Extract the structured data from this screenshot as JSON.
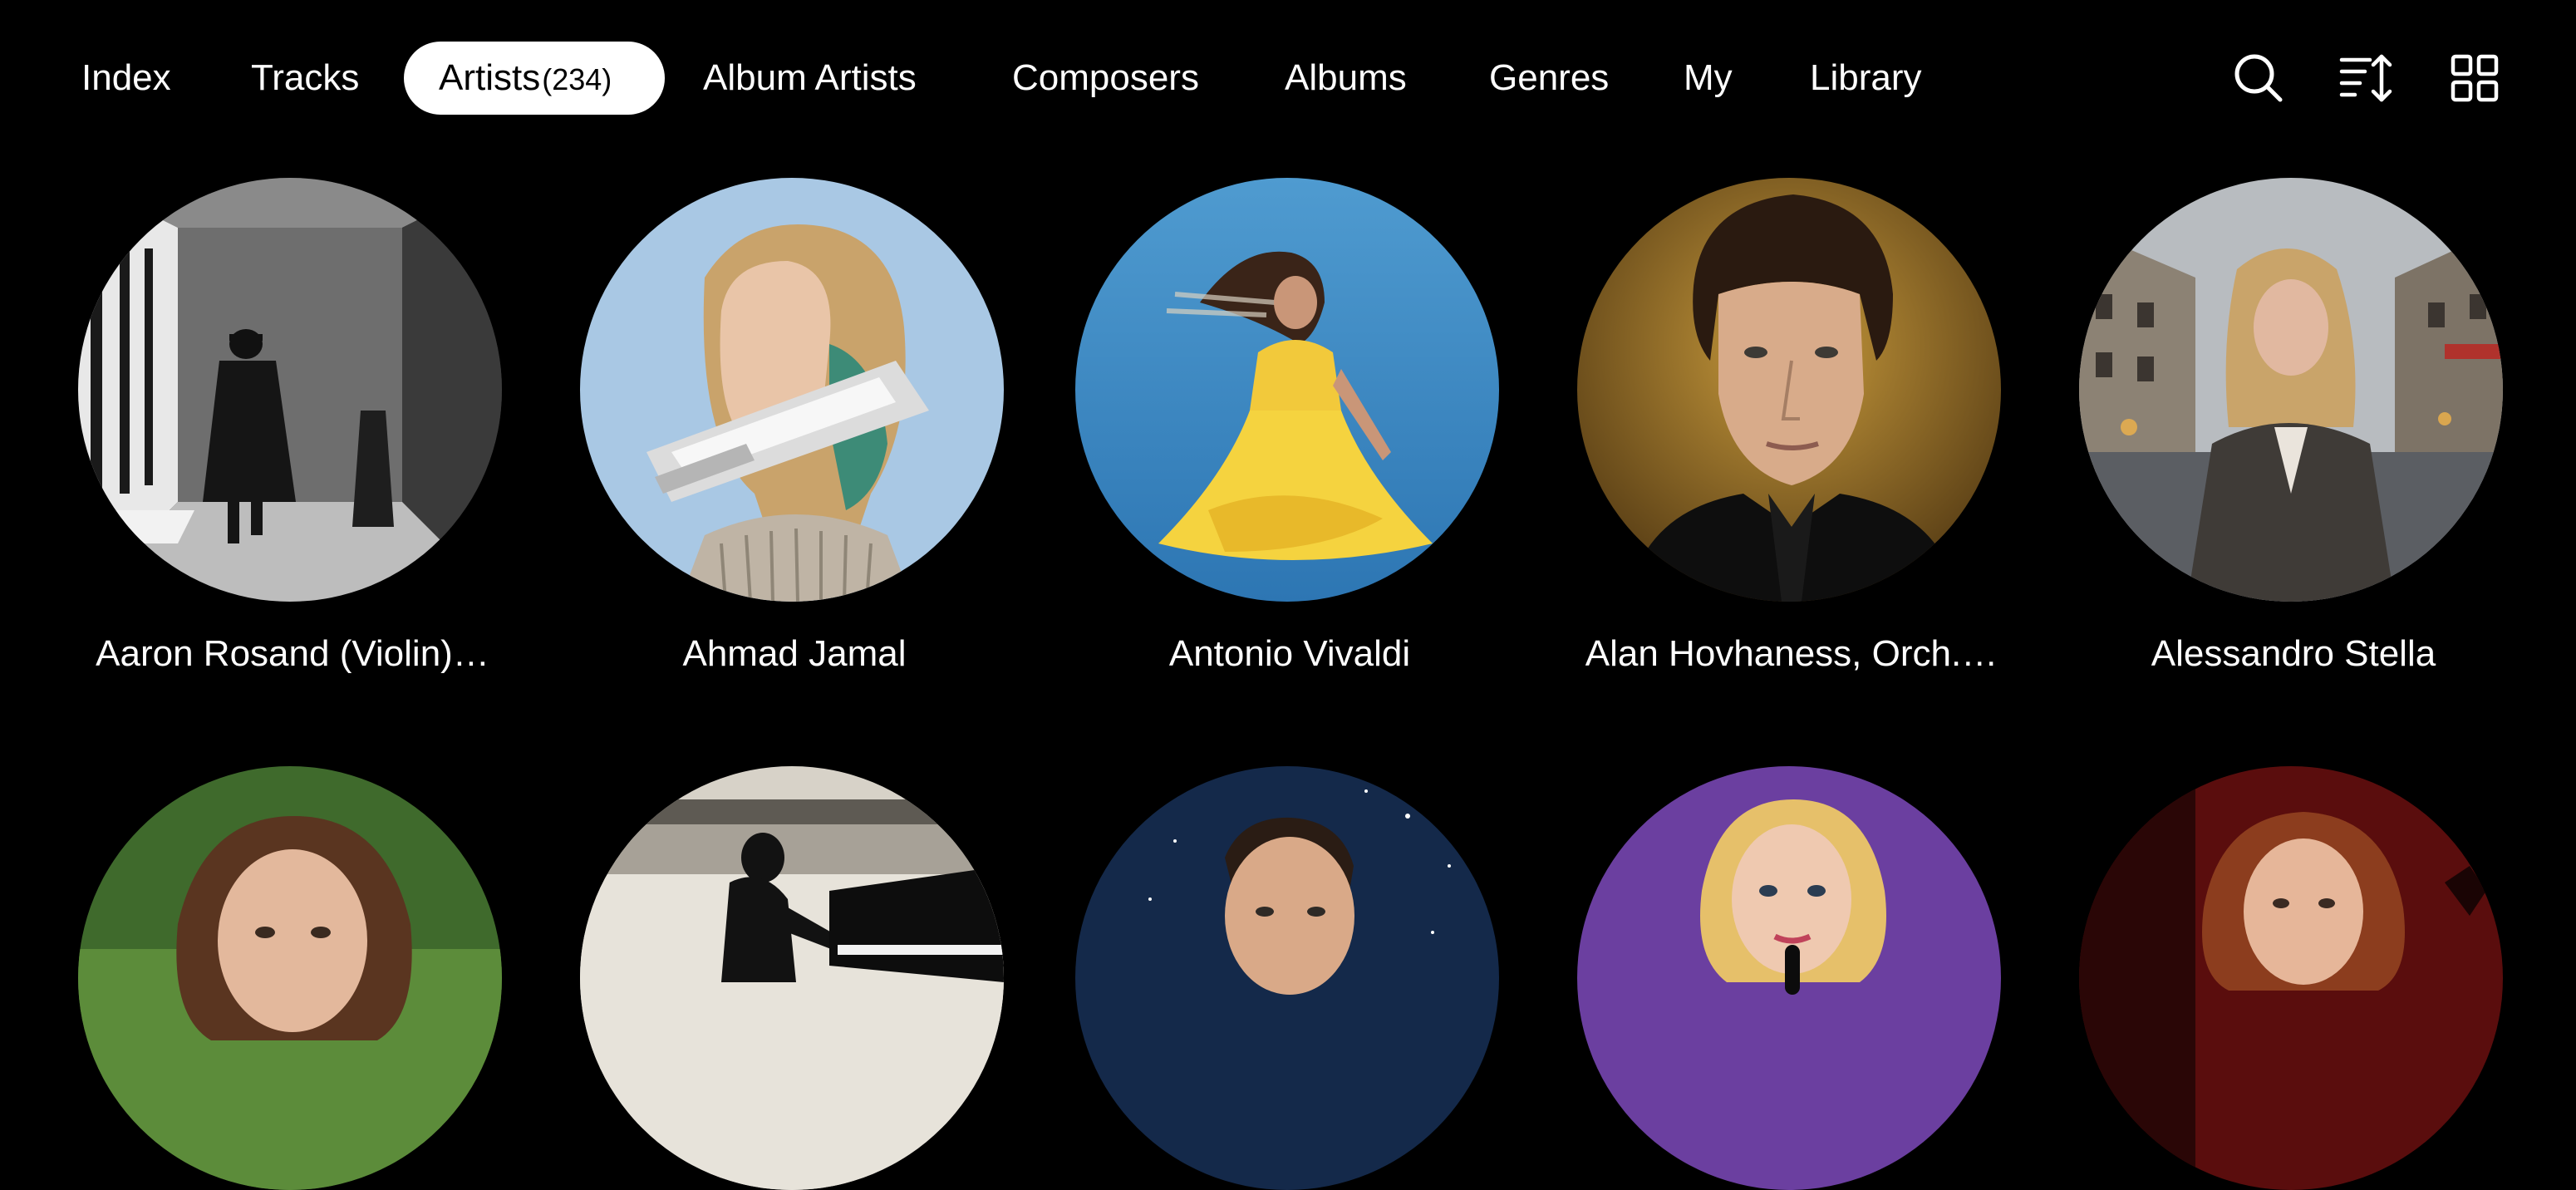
{
  "nav": {
    "tabs": [
      {
        "label": "Index"
      },
      {
        "label": "Tracks"
      },
      {
        "label": "Artists",
        "count": "(234)",
        "active": true
      },
      {
        "label": "Album Artists"
      },
      {
        "label": "Composers"
      },
      {
        "label": "Albums"
      },
      {
        "label": "Genres"
      },
      {
        "label": "My"
      },
      {
        "label": "Library"
      }
    ],
    "tools": [
      "search-icon",
      "sort-icon",
      "grid-view-icon"
    ]
  },
  "artists": [
    {
      "name": "Aaron Rosand (Violin)…"
    },
    {
      "name": "Ahmad Jamal"
    },
    {
      "name": "Antonio Vivaldi"
    },
    {
      "name": "Alan Hovhaness, Orch.…"
    },
    {
      "name": "Alessandro Stella"
    },
    {
      "name": ""
    },
    {
      "name": ""
    },
    {
      "name": ""
    },
    {
      "name": ""
    },
    {
      "name": ""
    }
  ],
  "colors": {
    "background": "#000000",
    "text": "#ffffff",
    "active_tab_bg": "#ffffff",
    "active_tab_text": "#000000"
  }
}
